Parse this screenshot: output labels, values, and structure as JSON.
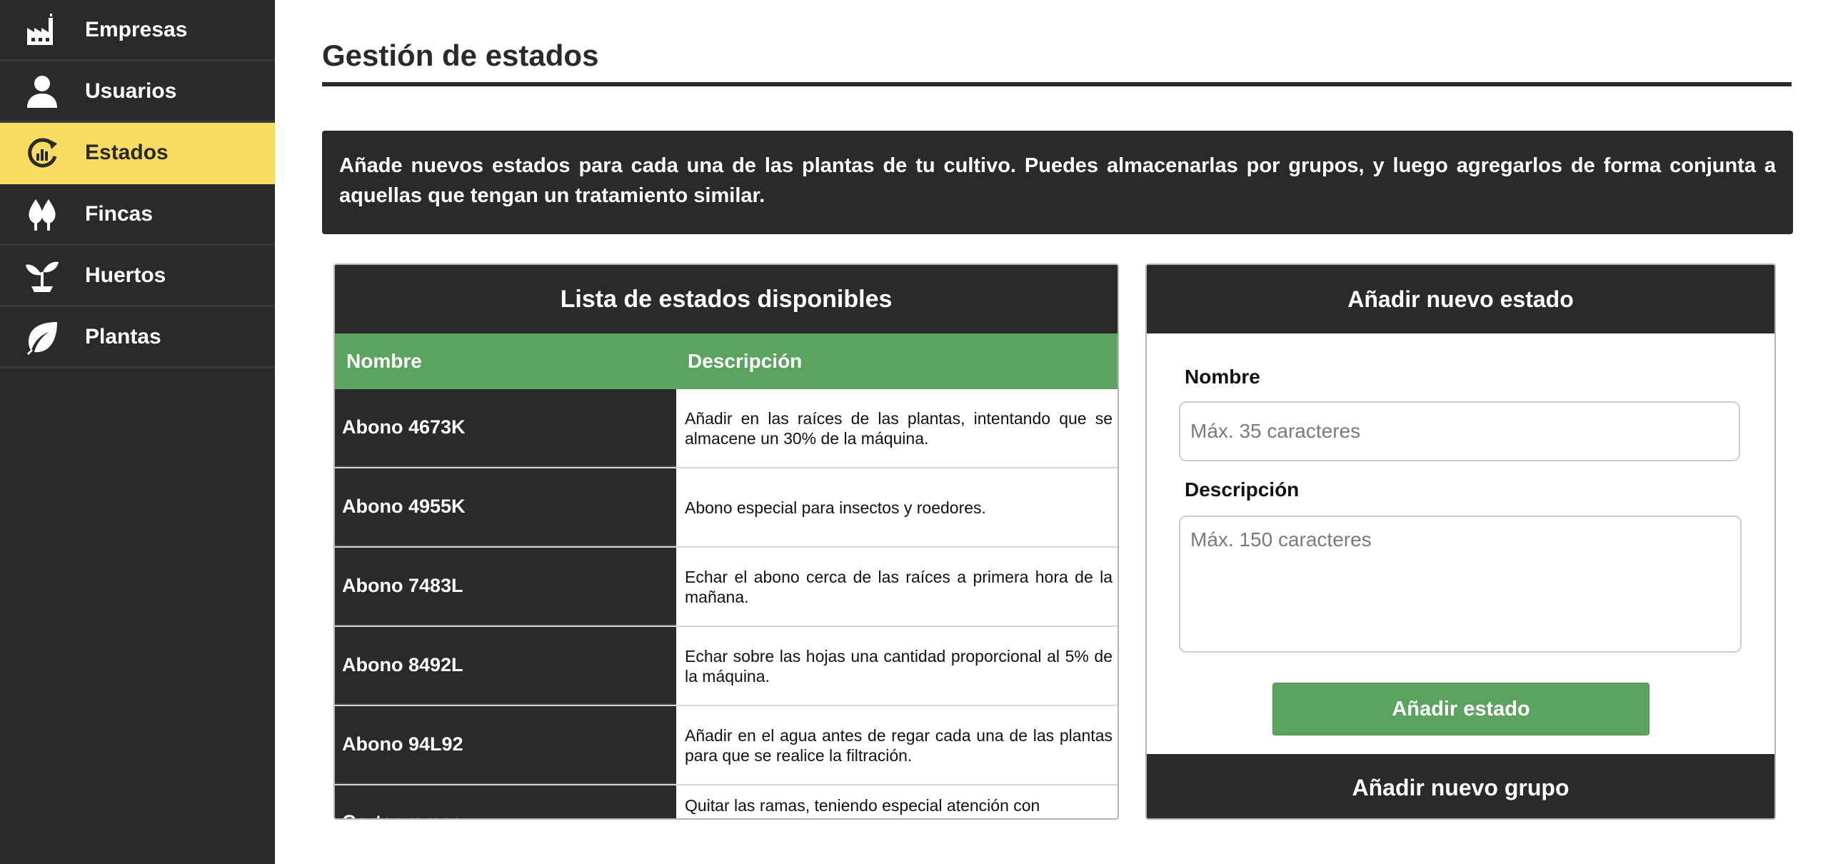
{
  "sidebar": {
    "items": [
      {
        "label": "Empresas",
        "icon": "factory-icon"
      },
      {
        "label": "Usuarios",
        "icon": "user-icon"
      },
      {
        "label": "Estados",
        "icon": "refresh-chart-icon",
        "active": true
      },
      {
        "label": "Fincas",
        "icon": "trees-icon"
      },
      {
        "label": "Huertos",
        "icon": "sprout-icon"
      },
      {
        "label": "Plantas",
        "icon": "leaf-icon"
      }
    ]
  },
  "page": {
    "title": "Gestión de estados",
    "intro": "Añade nuevos estados para cada una de las plantas de tu cultivo. Puedes almacenarlas por grupos, y luego agregarlos de forma conjunta a aquellas que tengan un tratamiento similar."
  },
  "list": {
    "title": "Lista de estados disponibles",
    "columns": [
      "Nombre",
      "Descripción"
    ],
    "rows": [
      {
        "name": "Abono 4673K",
        "desc": "Añadir en las raíces de las plantas, intentando que se almacene un 30% de la máquina."
      },
      {
        "name": "Abono 4955K",
        "desc": "Abono especial para insectos y roedores."
      },
      {
        "name": "Abono 7483L",
        "desc": "Echar el abono cerca de las raíces a primera hora de la mañana."
      },
      {
        "name": "Abono 8492L",
        "desc": "Echar sobre las hojas una cantidad proporcional al 5% de la máquina."
      },
      {
        "name": "Abono 94L92",
        "desc": "Añadir en el agua antes de regar cada una de las plantas para que se realice la filtración."
      },
      {
        "name": "Cortar ramas",
        "desc": "Quitar las ramas, teniendo especial atención con"
      }
    ]
  },
  "form": {
    "title": "Añadir nuevo estado",
    "name_label": "Nombre",
    "name_placeholder": "Máx. 35 caracteres",
    "desc_label": "Descripción",
    "desc_placeholder": "Máx. 150 caracteres",
    "submit_label": "Añadir estado",
    "group_title": "Añadir nuevo grupo"
  },
  "colors": {
    "dark": "#2a2a2a",
    "accent_yellow": "#f7dc61",
    "accent_green": "#5ba35f"
  }
}
